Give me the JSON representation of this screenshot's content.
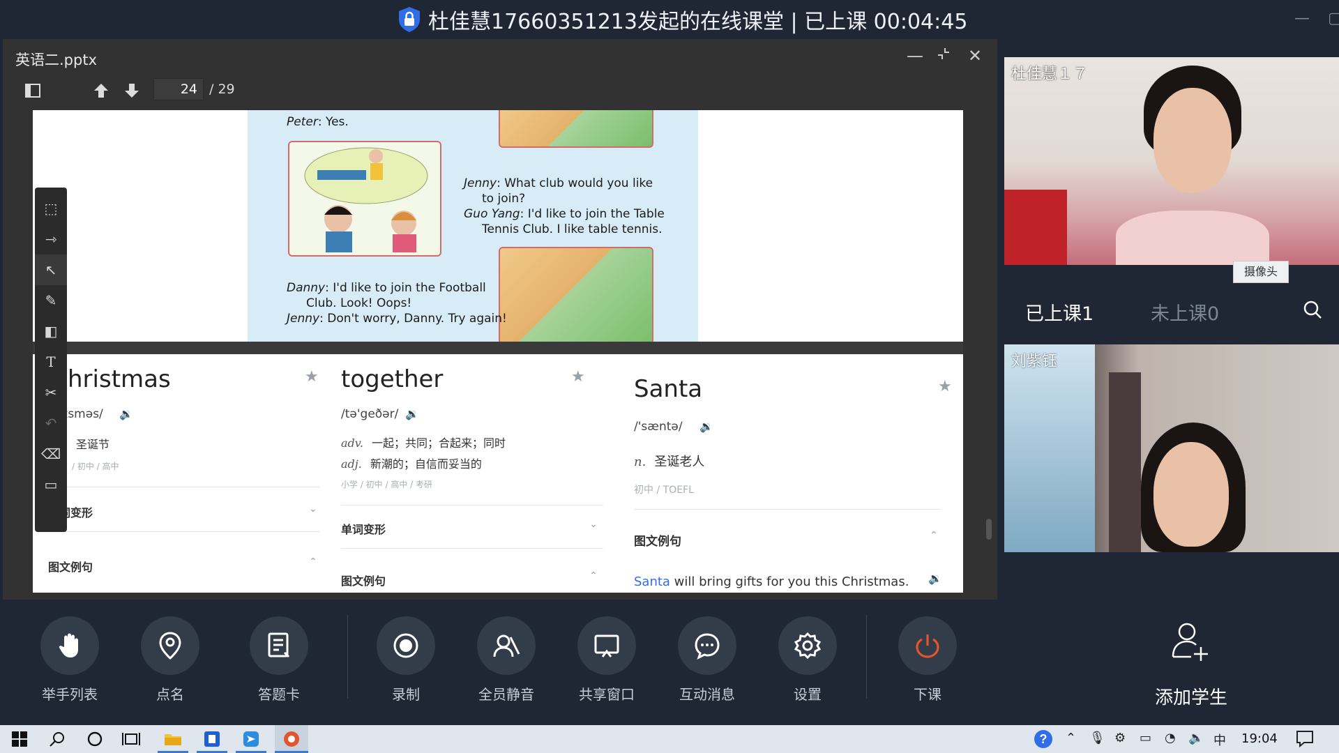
{
  "session": {
    "title": "杜佳慧17660351213发起的在线课堂 | 已上课 00:04:45"
  },
  "doc": {
    "filename": "英语二.pptx",
    "page_current": "24",
    "page_total": "/ 29"
  },
  "comic": {
    "lines": [
      {
        "speaker": "Peter",
        "text": ": Yes."
      },
      {
        "speaker": "Jenny",
        "text": ": What club would you like"
      },
      {
        "speaker": "",
        "text": "to join?"
      },
      {
        "speaker": "Guo Yang",
        "text": ": I'd like to join the Table"
      },
      {
        "speaker": "",
        "text": "Tennis Club. I like table tennis."
      },
      {
        "speaker": "Danny",
        "text": ": I'd like to join the Football"
      },
      {
        "speaker": "",
        "text": "Club. Look! Oops!"
      },
      {
        "speaker": "Jenny",
        "text": ": Don't worry, Danny. Try again!"
      }
    ]
  },
  "cards": [
    {
      "word": "hristmas",
      "pron": "ɪsməs/",
      "defs": [
        {
          "pos": "",
          "text": "圣诞节"
        }
      ],
      "levels": "/ 初中 / 高中",
      "sections": [
        "单词变形",
        "图文例句"
      ]
    },
    {
      "word": "together",
      "pron": "/tə'geðər/",
      "defs": [
        {
          "pos": "adv.",
          "text": "一起；共同；合起来；同时"
        },
        {
          "pos": "adj.",
          "text": "新潮的；自信而妥当的"
        }
      ],
      "levels": "小学 / 初中 / 高中 / 考研",
      "sections": [
        "单词变形",
        "图文例句"
      ]
    },
    {
      "word": "Santa",
      "pron": "/'sæntə/",
      "defs": [
        {
          "pos": "n.",
          "text": "圣诞老人"
        }
      ],
      "levels": "初中 / TOEFL",
      "sections": [
        "图文例句"
      ],
      "example_highlight": "Santa",
      "example_rest": " will bring gifts for you this Christmas."
    }
  ],
  "participants": {
    "video1_name": "杜佳慧１７",
    "video2_name": "刘紫钰",
    "camera_label": "摄像头",
    "tab_in": "已上课1",
    "tab_out": "未上课0",
    "add_student": "添加学生"
  },
  "controls": [
    {
      "label": "举手列表",
      "icon": "raise-hand-icon"
    },
    {
      "label": "点名",
      "icon": "location-pin-icon"
    },
    {
      "label": "答题卡",
      "icon": "answer-card-icon"
    },
    {
      "label": "录制",
      "icon": "record-icon"
    },
    {
      "label": "全员静音",
      "icon": "mute-all-icon"
    },
    {
      "label": "共享窗口",
      "icon": "share-window-icon"
    },
    {
      "label": "互动消息",
      "icon": "chat-icon"
    },
    {
      "label": "设置",
      "icon": "gear-icon"
    },
    {
      "label": "下课",
      "icon": "power-icon"
    }
  ],
  "taskbar": {
    "time": "19:04",
    "ime": "中"
  },
  "colors": {
    "bg_dark": "#1e2733",
    "accent_blue": "#2f6ee6",
    "end_class_red": "#e2552d"
  }
}
